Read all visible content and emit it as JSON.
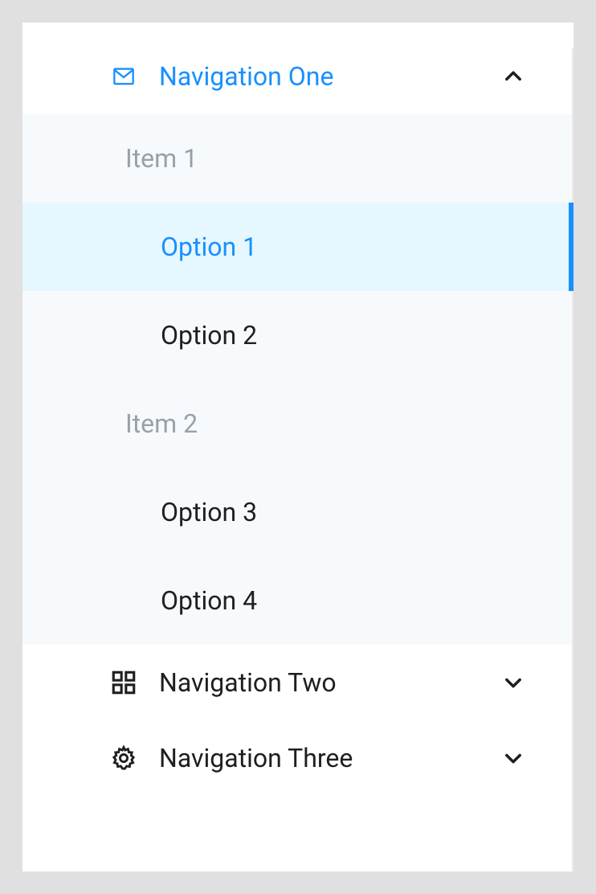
{
  "nav": [
    {
      "id": "nav-one",
      "label": "Navigation One",
      "icon": "mail-icon",
      "expanded": true,
      "groups": [
        {
          "title": "Item 1",
          "options": [
            {
              "label": "Option 1",
              "selected": true
            },
            {
              "label": "Option 2",
              "selected": false
            }
          ]
        },
        {
          "title": "Item 2",
          "options": [
            {
              "label": "Option 3",
              "selected": false
            },
            {
              "label": "Option 4",
              "selected": false
            }
          ]
        }
      ]
    },
    {
      "id": "nav-two",
      "label": "Navigation Two",
      "icon": "app-icon",
      "expanded": false
    },
    {
      "id": "nav-three",
      "label": "Navigation Three",
      "icon": "gear-icon",
      "expanded": false
    }
  ],
  "colors": {
    "primary": "#1890ff",
    "selectedBg": "#e6f7ff",
    "submenuBg": "#f7fafc",
    "text": "#1f1f1f",
    "muted": "#9aa0a6"
  }
}
